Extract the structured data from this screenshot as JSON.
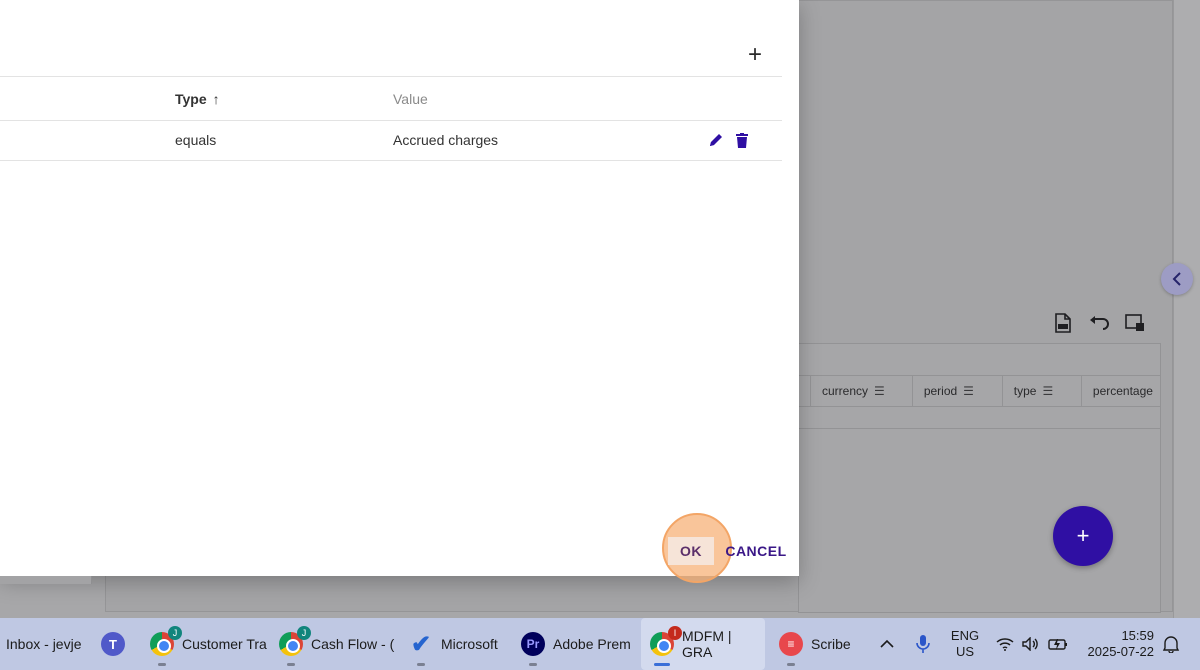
{
  "background": {
    "table_columns": [
      {
        "label": "currency"
      },
      {
        "label": "period"
      },
      {
        "label": "type"
      },
      {
        "label": "percentage"
      }
    ],
    "fab_label": "+"
  },
  "dialog": {
    "add_label": "+",
    "columns": {
      "type_label": "Type",
      "type_sort_icon": "↑",
      "value_label": "Value"
    },
    "rows": [
      {
        "type": "equals",
        "value": "Accrued charges"
      }
    ],
    "ok_label": "OK",
    "cancel_label": "CANCEL"
  },
  "taskbar": {
    "items": [
      {
        "label": "Inbox - jevje"
      },
      {
        "label": "Customer Tra"
      },
      {
        "label": "Cash Flow - (",
        "badge": "J"
      },
      {
        "label": "Microsoft"
      },
      {
        "label": "Adobe Prem"
      },
      {
        "label": "MDFM | GRA",
        "badge": "I"
      },
      {
        "label": "Scribe"
      }
    ],
    "customer_badge": "J",
    "teams_icon": "T",
    "pr_icon": "Pr",
    "lang_line1": "ENG",
    "lang_line2": "US",
    "time": "15:59",
    "date": "2025-07-22"
  },
  "colors": {
    "accent": "#2f0fa3",
    "cancel_text": "#3a1787",
    "highlight": "#f7b278"
  }
}
